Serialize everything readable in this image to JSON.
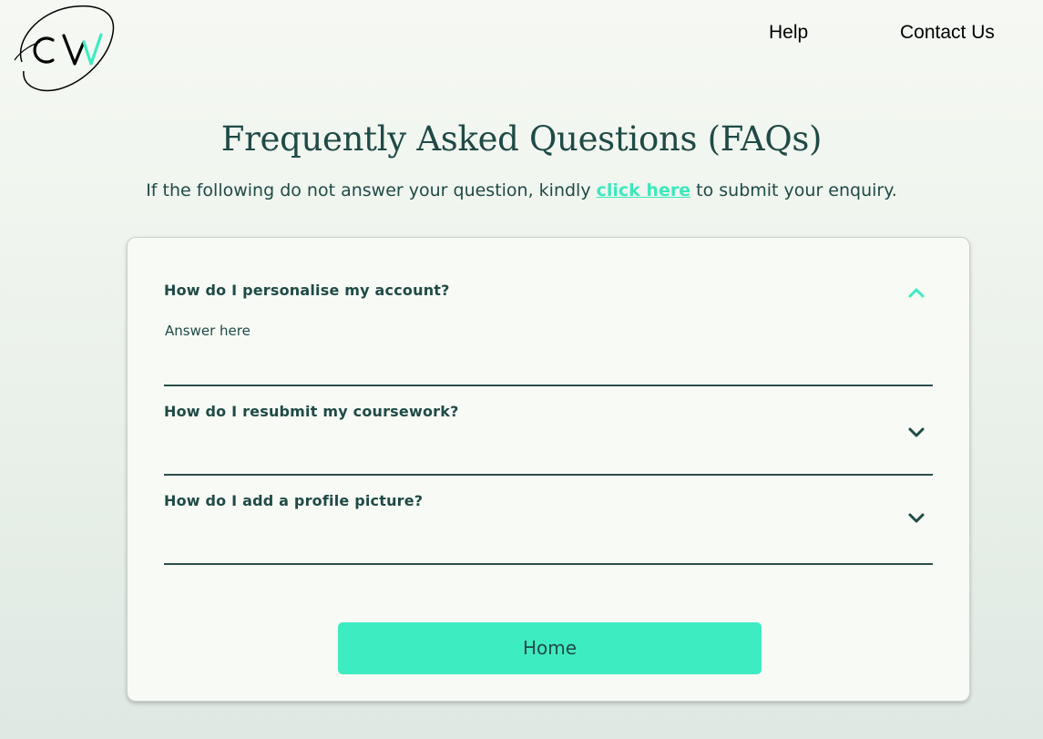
{
  "header": {
    "logo_text": "CW",
    "nav": [
      {
        "label": "Help"
      },
      {
        "label": "Contact Us"
      }
    ]
  },
  "main": {
    "title": "Frequently Asked Questions (FAQs)",
    "subtitle_before": "If the following do not answer your question, kindly ",
    "subtitle_link": "click here",
    "subtitle_after": " to submit your enquiry."
  },
  "faqs": [
    {
      "question": "How do I personalise my account?",
      "answer": "Answer here",
      "expanded": true,
      "icon": "chevron-up-icon"
    },
    {
      "question": "How do I resubmit my coursework?",
      "expanded": false,
      "icon": "chevron-down-icon"
    },
    {
      "question": "How do I add a profile picture?",
      "expanded": false,
      "icon": "chevron-down-icon"
    }
  ],
  "actions": {
    "home_label": "Home"
  },
  "colors": {
    "accent": "#3eecc1",
    "link": "#3ee8bd",
    "text": "#1f4a46",
    "card_bg": "#f7faf5"
  }
}
